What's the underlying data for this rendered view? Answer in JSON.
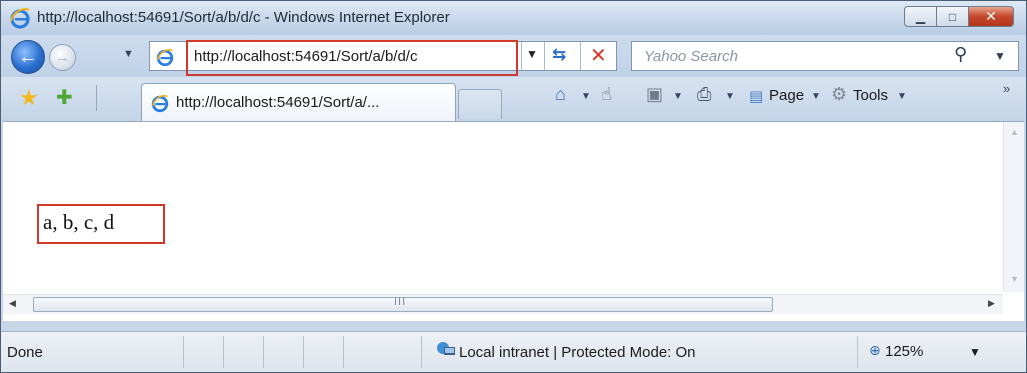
{
  "window": {
    "title": "http://localhost:54691/Sort/a/b/d/c - Windows Internet Explorer",
    "minimize_glyph": "▁",
    "maximize_glyph": "□",
    "close_glyph": "✕"
  },
  "navigation": {
    "back_glyph": "←",
    "forward_glyph": "→",
    "history_dropdown_glyph": "▼",
    "address": "http://localhost:54691/Sort/a/b/d/c",
    "address_dropdown_glyph": "▼",
    "refresh_glyph": "⇆",
    "stop_glyph": "✕"
  },
  "search": {
    "placeholder": "Yahoo Search",
    "search_glyph": "⚲",
    "dropdown_glyph": "▼"
  },
  "toolbar": {
    "favorites_glyph": "★",
    "add_favorite_glyph": "✚",
    "tab_label": "http://localhost:54691/Sort/a/...",
    "home_glyph": "⌂",
    "research_glyph": "☝",
    "feeds_glyph": "▣",
    "print_glyph": "⎙",
    "page_label": "Page",
    "tools_label": "Tools",
    "dropdown_glyph": "▼",
    "overflow_glyph": "»"
  },
  "content": {
    "result_text": "a, b, c, d",
    "scroll_up_glyph": "▲",
    "scroll_down_glyph": "▼",
    "scroll_left_glyph": "◀",
    "scroll_right_glyph": "▶",
    "scroll_grip": "III"
  },
  "status": {
    "text": "Done",
    "zone": "Local intranet | Protected Mode: On",
    "zoom_glyph": "⊕",
    "zoom": "125%",
    "zoom_dropdown_glyph": "▼"
  },
  "colors": {
    "highlight_border": "#d03a2c",
    "ie_blue": "#1f6fd1",
    "close_red": "#c4472b"
  }
}
